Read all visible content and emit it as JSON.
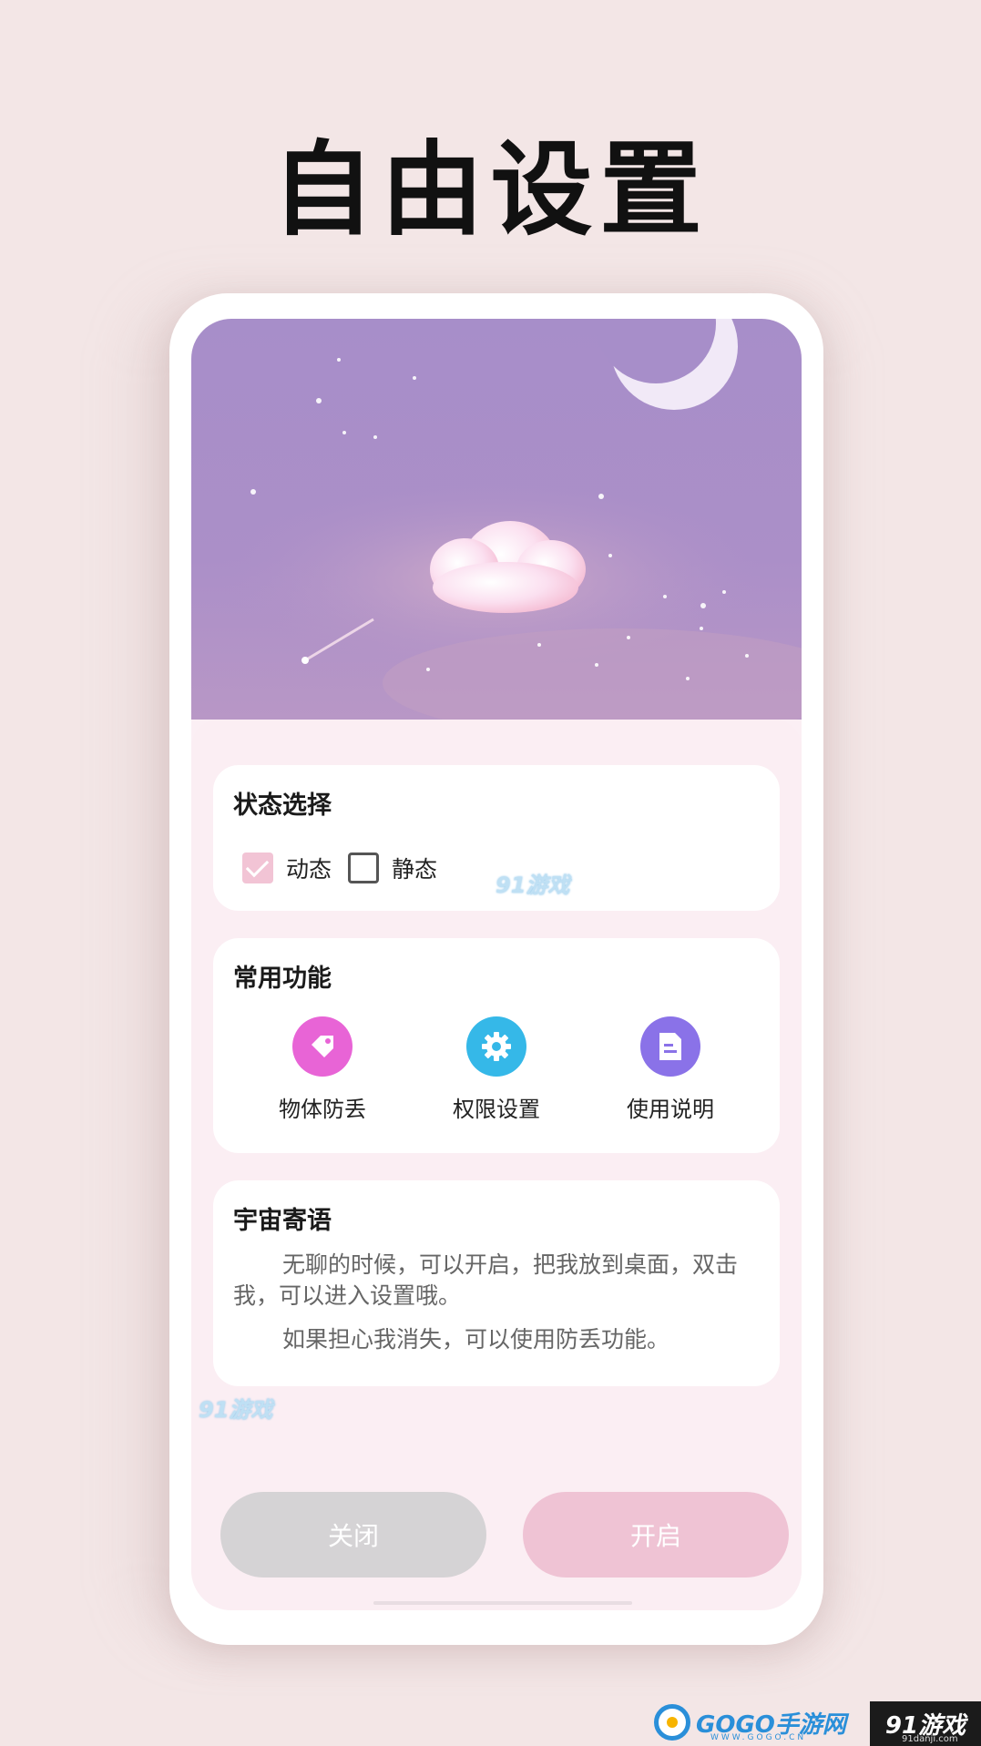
{
  "promo": {
    "title": "自由设置"
  },
  "status_card": {
    "title": "状态选择",
    "options": [
      {
        "label": "动态",
        "checked": true
      },
      {
        "label": "静态",
        "checked": false
      }
    ]
  },
  "func_card": {
    "title": "常用功能",
    "items": [
      {
        "label": "物体防丢",
        "icon": "tag-icon",
        "color": "#e864d6"
      },
      {
        "label": "权限设置",
        "icon": "gear-icon",
        "color": "#35b8e8"
      },
      {
        "label": "使用说明",
        "icon": "document-icon",
        "color": "#8a72e8"
      }
    ]
  },
  "msg_card": {
    "title": "宇宙寄语",
    "line1": "无聊的时候，可以开启，把我放到桌面，双击我，可以进入设置哦。",
    "line2": "如果担心我消失，可以使用防丢功能。"
  },
  "buttons": {
    "close_label": "关闭",
    "open_label": "开启"
  },
  "watermarks": {
    "app_wm": "91游戏",
    "footer_left": "GOGO手游网",
    "footer_left_sub": "WWW.GOGO.CN",
    "footer_right": "91游戏",
    "footer_right_sub": "91danji.com"
  },
  "colors": {
    "background": "#f3e6e6",
    "hero": "#a78ec9",
    "accent_pink": "#efc3d4",
    "button_grey": "#d5d3d5"
  }
}
